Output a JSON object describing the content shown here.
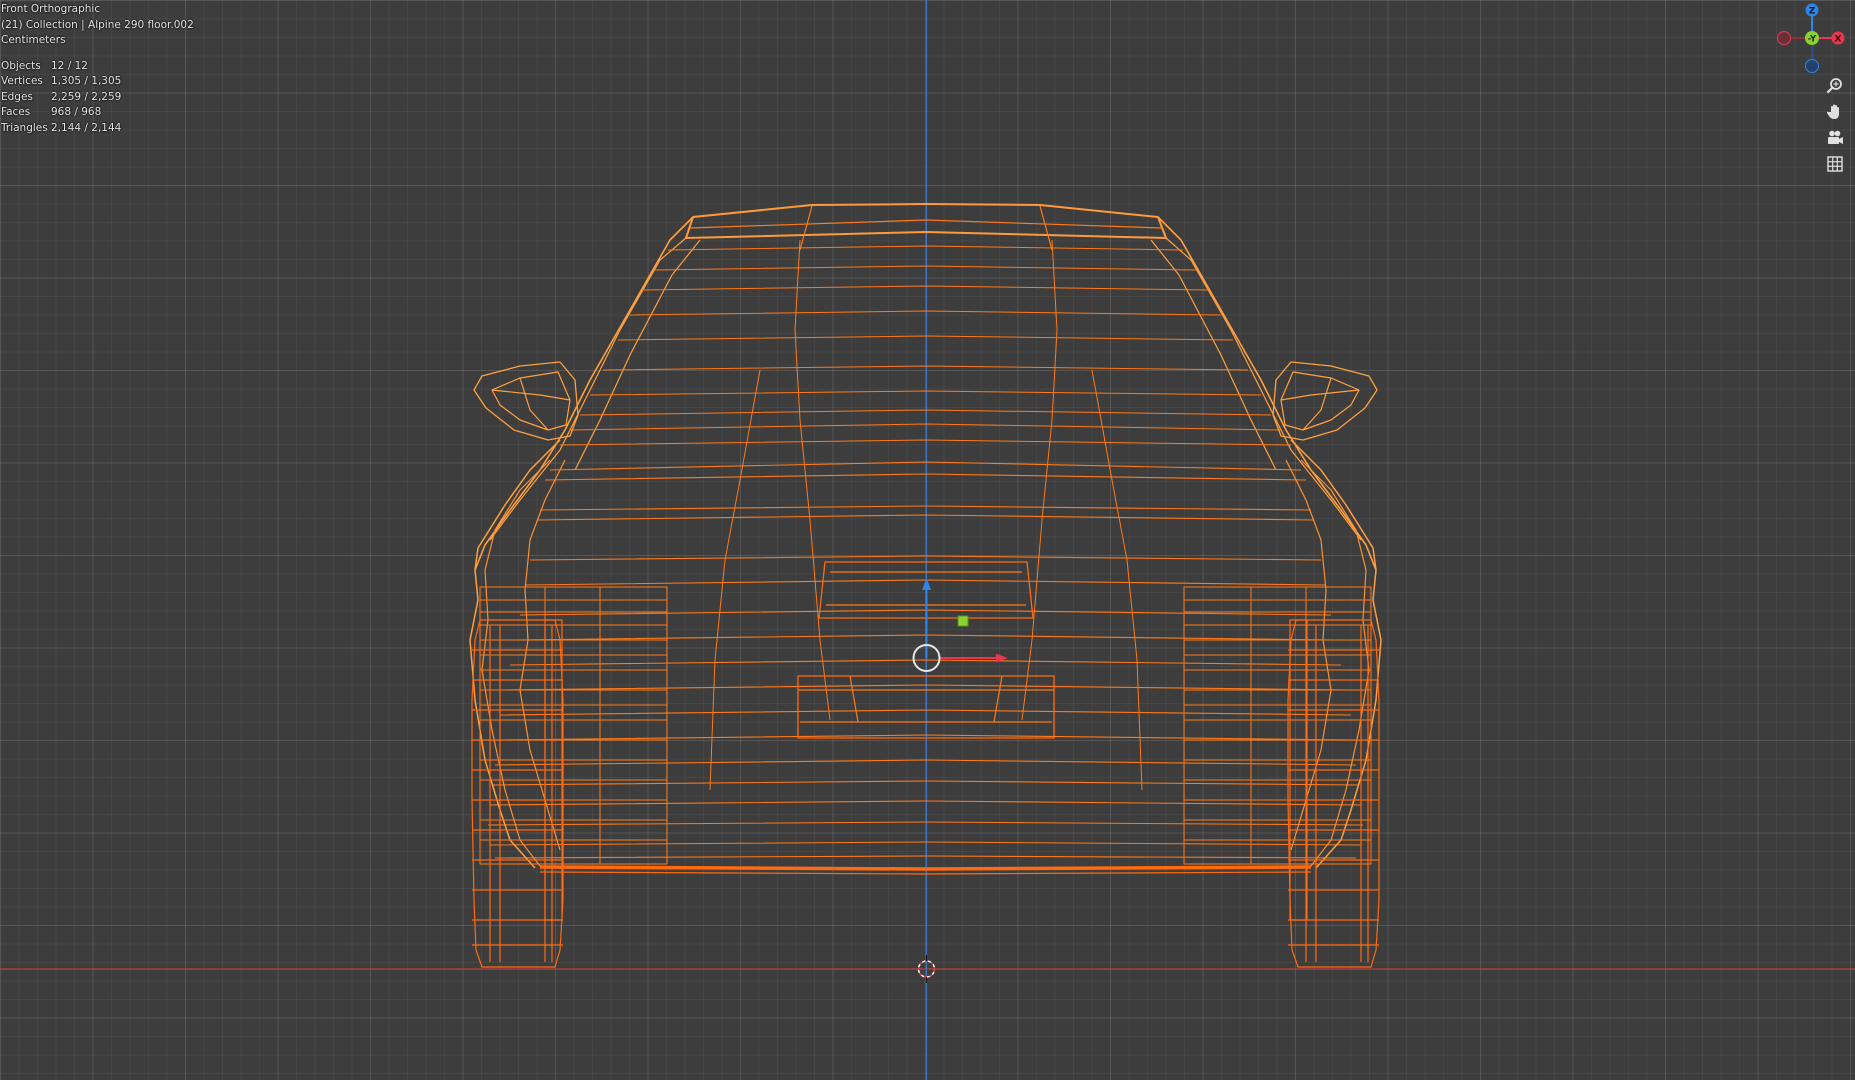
{
  "viewport": {
    "view_name": "Front Orthographic",
    "collection_info": "(21) Collection | Alpine 290 floor.002",
    "units": "Centimeters"
  },
  "stats": [
    {
      "label": "Objects",
      "value": "12 / 12"
    },
    {
      "label": "Vertices",
      "value": "1,305 / 1,305"
    },
    {
      "label": "Edges",
      "value": "2,259 / 2,259"
    },
    {
      "label": "Faces",
      "value": "968 / 968"
    },
    {
      "label": "Triangles",
      "value": "2,144 / 2,144"
    }
  ],
  "gizmo": {
    "z_label": "Z",
    "y_label": "-Y",
    "x_label": "X"
  },
  "tools": [
    {
      "name": "zoom-icon"
    },
    {
      "name": "pan-hand-icon"
    },
    {
      "name": "camera-icon"
    },
    {
      "name": "grid-icon"
    }
  ],
  "colors": {
    "background": "#3d3d3d",
    "wire": "#ff7a1a",
    "wire_highlight": "#ffb24a",
    "x_axis": "#e8384f",
    "y_axis": "#8bd12f",
    "z_axis": "#2f84e8"
  }
}
